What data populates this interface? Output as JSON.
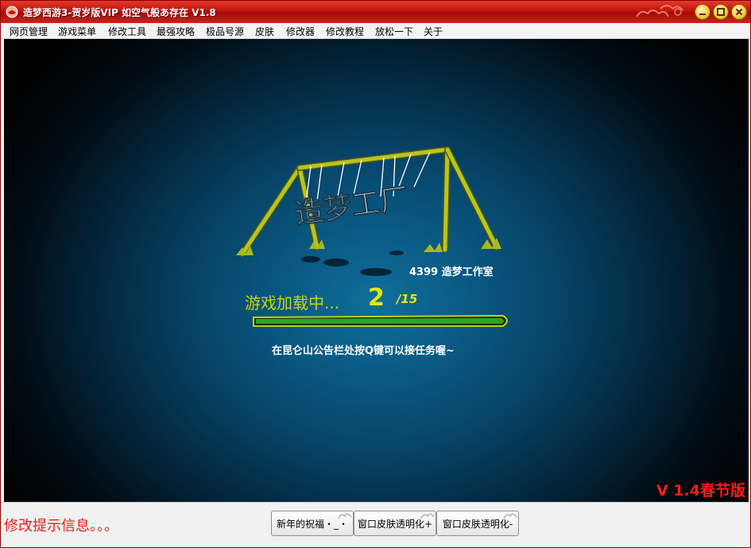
{
  "window": {
    "title": "造梦西游3-贺岁版VIP 如空气般あ存在 V1.8",
    "accent_color": "#c0140d",
    "buttons": [
      "minimize",
      "restore",
      "close"
    ]
  },
  "menu": {
    "items": [
      "网页管理",
      "游戏菜单",
      "修改工具",
      "最强攻略",
      "极品号源",
      "皮肤",
      "修改器",
      "修改教程",
      "放松一下",
      "关于"
    ]
  },
  "game": {
    "logo_text": "造梦工厂",
    "studio": "4399 造梦工作室",
    "loading_label": "游戏加载中...",
    "loading_current": "2",
    "loading_total": "/15",
    "loading_progress": 1.0,
    "tip": "在昆仑山公告栏处按Q键可以接任务喔~",
    "version": "V 1.4春节版",
    "version_color": "#ff1a1a"
  },
  "status": {
    "message": "修改提示信息。。。",
    "message_color": "#ee1c1c",
    "buttons": [
      "新年的祝福・_・",
      "窗口皮肤透明化+",
      "窗口皮肤透明化-"
    ]
  }
}
